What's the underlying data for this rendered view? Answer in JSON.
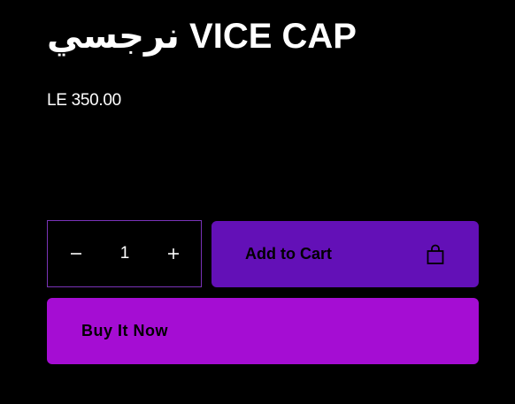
{
  "product": {
    "title": "نرجسي VICE CAP",
    "price": "LE 350.00"
  },
  "quantity": {
    "value": "1",
    "decrease_icon": "minus-icon",
    "increase_icon": "plus-icon"
  },
  "actions": {
    "add_to_cart_label": "Add to Cart",
    "add_to_cart_icon": "shopping-bag-icon",
    "buy_now_label": "Buy It Now"
  },
  "colors": {
    "background": "#000000",
    "add_to_cart": "#6310b7",
    "buy_now": "#a50dd3",
    "quantity_border": "#7a33b8"
  }
}
